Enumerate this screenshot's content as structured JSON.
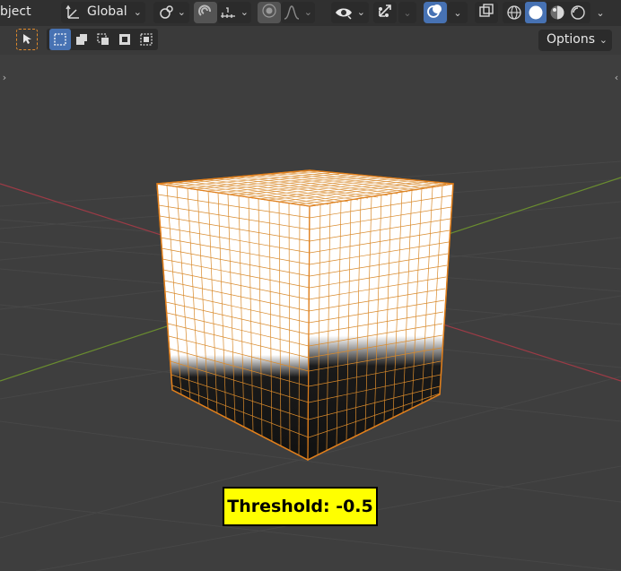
{
  "header": {
    "mode_label": "bject",
    "orientation_label": "Global",
    "options_label": "Options"
  },
  "icons": {
    "mode": "object-mode-icon",
    "orientation": "transform-orientation-icon",
    "pivot": "pivot-point-icon",
    "snap": "snap-icon",
    "snap_increment": "snap-increment-icon",
    "proportional": "proportional-editing-icon",
    "falloff": "falloff-curve-icon",
    "visibility": "eye-icon",
    "gizmo": "gizmo-icon",
    "overlay": "overlay-icon",
    "xray": "xray-icon",
    "wireframe": "wireframe-shading-icon",
    "solid": "solid-shading-icon",
    "material": "material-preview-icon",
    "rendered": "rendered-shading-icon"
  },
  "viewport": {
    "threshold_text": "Threshold: -0.5"
  },
  "colors": {
    "background": "#3e3e3e",
    "header": "#303030",
    "active_button": "#4772b3",
    "mesh_edge": "#e07f1c",
    "x_axis": "#9c3b46",
    "y_axis": "#6a8d2f",
    "threshold_bg": "#ffff00"
  }
}
